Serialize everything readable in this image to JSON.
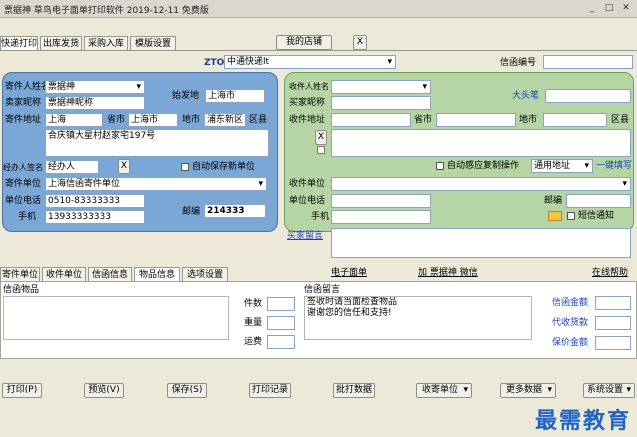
{
  "title": "票据神 草鸟电子面单打印软件 2019-12-11 免费版",
  "tabs": [
    "快递打印",
    "出库发货",
    "采购入库",
    "模版设置"
  ],
  "store_button": "我的店铺",
  "close_x": "X",
  "carrier": {
    "code": "ZTO",
    "selected": "中通快递lt"
  },
  "mail_no_label": "信函编号",
  "sender": {
    "name_label": "寄件人姓名",
    "name": "票据神",
    "nick_label": "卖家昵称",
    "nick": "票据神昵称",
    "origin_label": "始发地",
    "origin": "上海市",
    "addr_label": "寄件地址",
    "province_label": "省市",
    "city_label": "地市",
    "district_label": "区县",
    "province": "上海",
    "city": "上海市",
    "district": "浦东新区",
    "address": "合庆镇大星村赵家宅197号",
    "sign_label": "经办人签名",
    "sign": "经办人",
    "sign_x": "X",
    "autosave": "自动保存新单位",
    "unit_label": "寄件单位",
    "unit": "上海信函寄件单位",
    "tel_label": "单位电话",
    "tel": "0510-83333333",
    "mobile_label": "手机",
    "mobile": "13933333333",
    "zip_label": "邮编",
    "zip": "214333"
  },
  "receiver": {
    "name_label": "收件人姓名",
    "nick_label": "买家昵称",
    "bigpen": "大头笔",
    "addr_label": "收件地址",
    "province_label": "省市",
    "city_label": "地市",
    "district_label": "区县",
    "x": "X",
    "auto_copy": "自动感应复制操作",
    "addr_type": "通用地址",
    "quick_fill": "一键填写",
    "unit_label": "收件单位",
    "tel_label": "单位电话",
    "zip_label": "邮编",
    "mobile_label": "手机",
    "sms": "短信通知"
  },
  "buyer_msg": "买家留言",
  "bottom_tabs": [
    "寄件单位",
    "收件单位",
    "信函信息",
    "物品信息",
    "选项设置"
  ],
  "links": {
    "esheet": "电子面单",
    "add": "加 票据神 微信",
    "help": "在线帮助"
  },
  "goods_label": "信函物品",
  "qty": {
    "count": "件数",
    "weight": "重量",
    "freight": "运费"
  },
  "message_label": "信函留言",
  "message_text": "签收时请当面检查物品\n谢谢您的信任和支持!",
  "money": [
    "信函金额",
    "代收货款",
    "保价金额"
  ],
  "buttons": [
    "打印(P)",
    "预览(V)",
    "保存(S)",
    "打印记录",
    "批打数据",
    "收寄单位",
    "更多数据",
    "系统设置"
  ],
  "watermark": "最需教育"
}
